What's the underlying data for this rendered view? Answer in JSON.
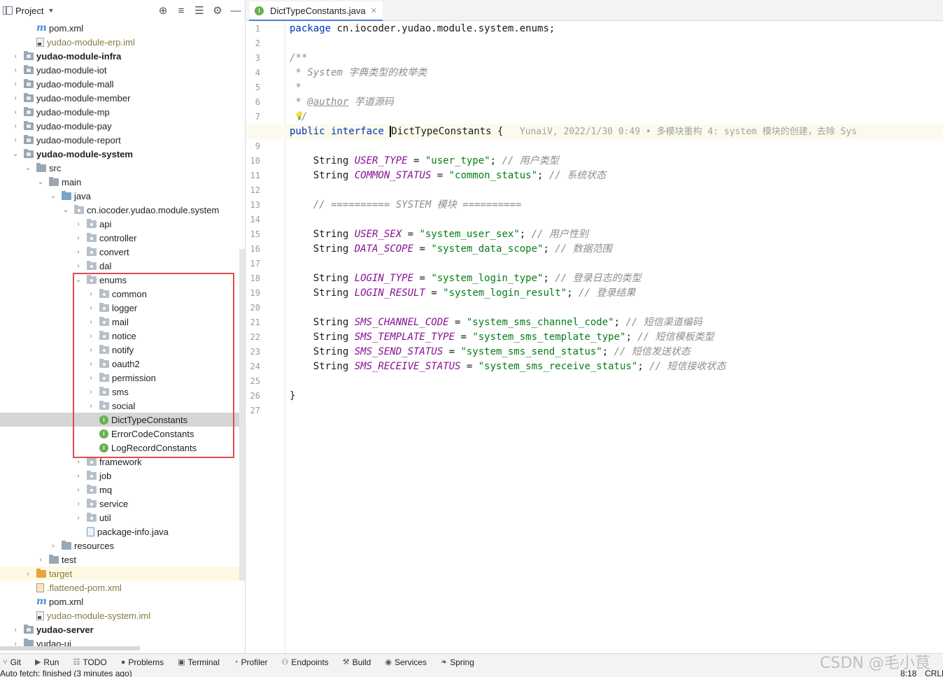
{
  "project_panel": {
    "title": "Project",
    "tree": [
      {
        "label": "pom.xml",
        "depth": 2,
        "icon": "maven",
        "chevron": "none"
      },
      {
        "label": "yudao-module-erp.iml",
        "depth": 2,
        "icon": "file",
        "chevron": "none",
        "muted": true
      },
      {
        "label": "yudao-module-infra",
        "depth": 1,
        "icon": "module",
        "chevron": "right",
        "bold": true
      },
      {
        "label": "yudao-module-iot",
        "depth": 1,
        "icon": "module",
        "chevron": "right"
      },
      {
        "label": "yudao-module-mall",
        "depth": 1,
        "icon": "module",
        "chevron": "right"
      },
      {
        "label": "yudao-module-member",
        "depth": 1,
        "icon": "module",
        "chevron": "right"
      },
      {
        "label": "yudao-module-mp",
        "depth": 1,
        "icon": "module",
        "chevron": "right"
      },
      {
        "label": "yudao-module-pay",
        "depth": 1,
        "icon": "module",
        "chevron": "right"
      },
      {
        "label": "yudao-module-report",
        "depth": 1,
        "icon": "module",
        "chevron": "right"
      },
      {
        "label": "yudao-module-system",
        "depth": 1,
        "icon": "module",
        "chevron": "down",
        "bold": true
      },
      {
        "label": "src",
        "depth": 2,
        "icon": "folder",
        "chevron": "down"
      },
      {
        "label": "main",
        "depth": 3,
        "icon": "folder",
        "chevron": "down"
      },
      {
        "label": "java",
        "depth": 4,
        "icon": "src",
        "chevron": "down"
      },
      {
        "label": "cn.iocoder.yudao.module.system",
        "depth": 5,
        "icon": "package",
        "chevron": "down"
      },
      {
        "label": "api",
        "depth": 6,
        "icon": "package",
        "chevron": "right"
      },
      {
        "label": "controller",
        "depth": 6,
        "icon": "package",
        "chevron": "right"
      },
      {
        "label": "convert",
        "depth": 6,
        "icon": "package",
        "chevron": "right"
      },
      {
        "label": "dal",
        "depth": 6,
        "icon": "package",
        "chevron": "right"
      },
      {
        "label": "enums",
        "depth": 6,
        "icon": "package",
        "chevron": "down"
      },
      {
        "label": "common",
        "depth": 7,
        "icon": "package",
        "chevron": "right"
      },
      {
        "label": "logger",
        "depth": 7,
        "icon": "package",
        "chevron": "right"
      },
      {
        "label": "mail",
        "depth": 7,
        "icon": "package",
        "chevron": "right"
      },
      {
        "label": "notice",
        "depth": 7,
        "icon": "package",
        "chevron": "right"
      },
      {
        "label": "notify",
        "depth": 7,
        "icon": "package",
        "chevron": "right"
      },
      {
        "label": "oauth2",
        "depth": 7,
        "icon": "package",
        "chevron": "right"
      },
      {
        "label": "permission",
        "depth": 7,
        "icon": "package",
        "chevron": "right"
      },
      {
        "label": "sms",
        "depth": 7,
        "icon": "package",
        "chevron": "right"
      },
      {
        "label": "social",
        "depth": 7,
        "icon": "package",
        "chevron": "right"
      },
      {
        "label": "DictTypeConstants",
        "depth": 7,
        "icon": "interface",
        "chevron": "none",
        "selected": true
      },
      {
        "label": "ErrorCodeConstants",
        "depth": 7,
        "icon": "interface",
        "chevron": "none"
      },
      {
        "label": "LogRecordConstants",
        "depth": 7,
        "icon": "interface",
        "chevron": "none"
      },
      {
        "label": "framework",
        "depth": 6,
        "icon": "package",
        "chevron": "right"
      },
      {
        "label": "job",
        "depth": 6,
        "icon": "package",
        "chevron": "right"
      },
      {
        "label": "mq",
        "depth": 6,
        "icon": "package",
        "chevron": "right"
      },
      {
        "label": "service",
        "depth": 6,
        "icon": "package",
        "chevron": "right"
      },
      {
        "label": "util",
        "depth": 6,
        "icon": "package",
        "chevron": "right"
      },
      {
        "label": "package-info.java",
        "depth": 6,
        "icon": "java",
        "chevron": "none"
      },
      {
        "label": "resources",
        "depth": 4,
        "icon": "folder",
        "chevron": "right"
      },
      {
        "label": "test",
        "depth": 3,
        "icon": "folder",
        "chevron": "right"
      },
      {
        "label": "target",
        "depth": 2,
        "icon": "orange",
        "chevron": "right",
        "muted": true,
        "target": true
      },
      {
        "label": ".flattened-pom.xml",
        "depth": 2,
        "icon": "xml",
        "chevron": "none",
        "muted": true
      },
      {
        "label": "pom.xml",
        "depth": 2,
        "icon": "maven",
        "chevron": "none"
      },
      {
        "label": "yudao-module-system.iml",
        "depth": 2,
        "icon": "file",
        "chevron": "none",
        "muted": true
      },
      {
        "label": "yudao-server",
        "depth": 1,
        "icon": "module",
        "chevron": "right",
        "bold": true
      },
      {
        "label": "yudao-ui",
        "depth": 1,
        "icon": "folder",
        "chevron": "right"
      }
    ]
  },
  "editor": {
    "tab_label": "DictTypeConstants.java",
    "lines": [
      [
        {
          "t": "package ",
          "c": "kw"
        },
        {
          "t": "cn.iocoder.yudao.module.system.enums;"
        }
      ],
      [],
      [
        {
          "t": "/**",
          "c": "cmt"
        }
      ],
      [
        {
          "t": " * System 字典类型的枚举类",
          "c": "cmt"
        }
      ],
      [
        {
          "t": " *",
          "c": "cmt"
        }
      ],
      [
        {
          "t": " * ",
          "c": "cmt"
        },
        {
          "t": "@author",
          "c": "tag"
        },
        {
          "t": " 芋道源码",
          "c": "cmt"
        }
      ],
      [
        {
          "t": " */",
          "c": "cmt"
        }
      ],
      [
        {
          "t": "public interface ",
          "c": "kw"
        },
        {
          "t": "DictTypeConstants {"
        },
        {
          "t": "   YunaiV, 2022/1/30 0:49 • 多模块重构 4: system 模块的创建，去除 Sys",
          "c": "blame"
        }
      ],
      [],
      [
        {
          "t": "    String "
        },
        {
          "t": "USER_TYPE",
          "c": "const"
        },
        {
          "t": " = "
        },
        {
          "t": "\"user_type\"",
          "c": "str"
        },
        {
          "t": "; "
        },
        {
          "t": "// 用户类型",
          "c": "cmt"
        }
      ],
      [
        {
          "t": "    String "
        },
        {
          "t": "COMMON_STATUS",
          "c": "const"
        },
        {
          "t": " = "
        },
        {
          "t": "\"common_status\"",
          "c": "str"
        },
        {
          "t": "; "
        },
        {
          "t": "// 系统状态",
          "c": "cmt"
        }
      ],
      [],
      [
        {
          "t": "    // ========== SYSTEM 模块 ==========",
          "c": "cmt"
        }
      ],
      [],
      [
        {
          "t": "    String "
        },
        {
          "t": "USER_SEX",
          "c": "const"
        },
        {
          "t": " = "
        },
        {
          "t": "\"system_user_sex\"",
          "c": "str"
        },
        {
          "t": "; "
        },
        {
          "t": "// 用户性别",
          "c": "cmt"
        }
      ],
      [
        {
          "t": "    String "
        },
        {
          "t": "DATA_SCOPE",
          "c": "const"
        },
        {
          "t": " = "
        },
        {
          "t": "\"system_data_scope\"",
          "c": "str"
        },
        {
          "t": "; "
        },
        {
          "t": "// 数据范围",
          "c": "cmt"
        }
      ],
      [],
      [
        {
          "t": "    String "
        },
        {
          "t": "LOGIN_TYPE",
          "c": "const"
        },
        {
          "t": " = "
        },
        {
          "t": "\"system_login_type\"",
          "c": "str"
        },
        {
          "t": "; "
        },
        {
          "t": "// 登录日志的类型",
          "c": "cmt"
        }
      ],
      [
        {
          "t": "    String "
        },
        {
          "t": "LOGIN_RESULT",
          "c": "const"
        },
        {
          "t": " = "
        },
        {
          "t": "\"system_login_result\"",
          "c": "str"
        },
        {
          "t": "; "
        },
        {
          "t": "// 登录结果",
          "c": "cmt"
        }
      ],
      [],
      [
        {
          "t": "    String "
        },
        {
          "t": "SMS_CHANNEL_CODE",
          "c": "const"
        },
        {
          "t": " = "
        },
        {
          "t": "\"system_sms_channel_code\"",
          "c": "str"
        },
        {
          "t": "; "
        },
        {
          "t": "// 短信渠道编码",
          "c": "cmt"
        }
      ],
      [
        {
          "t": "    String "
        },
        {
          "t": "SMS_TEMPLATE_TYPE",
          "c": "const"
        },
        {
          "t": " = "
        },
        {
          "t": "\"system_sms_template_type\"",
          "c": "str"
        },
        {
          "t": "; "
        },
        {
          "t": "// 短信模板类型",
          "c": "cmt"
        }
      ],
      [
        {
          "t": "    String "
        },
        {
          "t": "SMS_SEND_STATUS",
          "c": "const"
        },
        {
          "t": " = "
        },
        {
          "t": "\"system_sms_send_status\"",
          "c": "str"
        },
        {
          "t": "; "
        },
        {
          "t": "// 短信发送状态",
          "c": "cmt"
        }
      ],
      [
        {
          "t": "    String "
        },
        {
          "t": "SMS_RECEIVE_STATUS",
          "c": "const"
        },
        {
          "t": " = "
        },
        {
          "t": "\"system_sms_receive_status\"",
          "c": "str"
        },
        {
          "t": "; "
        },
        {
          "t": "// 短信接收状态",
          "c": "cmt"
        }
      ],
      [],
      [
        {
          "t": "}"
        }
      ],
      []
    ]
  },
  "tool_strip": [
    {
      "label": "Git",
      "icon": "git-icon"
    },
    {
      "label": "Run",
      "icon": "run-icon"
    },
    {
      "label": "TODO",
      "icon": "todo-icon"
    },
    {
      "label": "Problems",
      "icon": "problems-icon"
    },
    {
      "label": "Terminal",
      "icon": "terminal-icon"
    },
    {
      "label": "Profiler",
      "icon": "profiler-icon"
    },
    {
      "label": "Endpoints",
      "icon": "endpoints-icon"
    },
    {
      "label": "Build",
      "icon": "build-icon"
    },
    {
      "label": "Services",
      "icon": "services-icon"
    },
    {
      "label": "Spring",
      "icon": "spring-icon"
    }
  ],
  "status": {
    "message": "Auto fetch: finished (3 minutes ago)",
    "position": "8:18",
    "line_ending": "CRLF"
  },
  "watermark": "CSDN @毛小茛"
}
